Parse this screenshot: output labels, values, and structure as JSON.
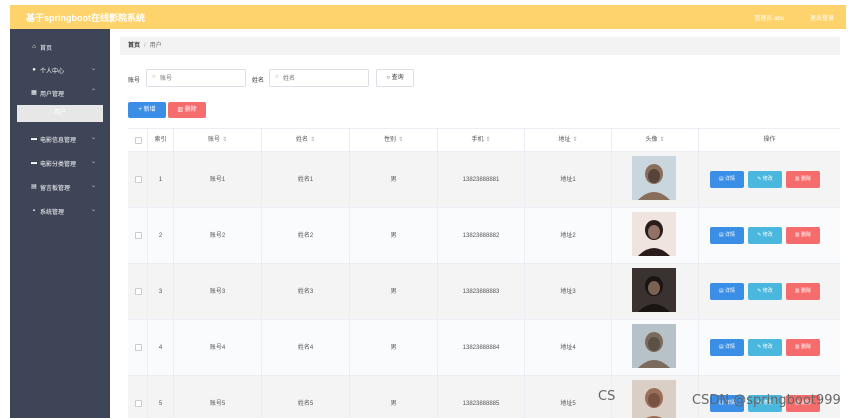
{
  "header": {
    "title": "基于springboot在线影院系统",
    "user_label": "管理员 abo",
    "logout_label": "退出登录"
  },
  "sidebar": {
    "items": [
      {
        "label": "首页",
        "icon": "home-icon"
      },
      {
        "label": "个人中心",
        "icon": "user-icon"
      },
      {
        "label": "用户管理",
        "icon": "grid-icon"
      },
      {
        "label": "电影信息管理",
        "icon": "film-icon"
      },
      {
        "label": "电影分类管理",
        "icon": "category-icon"
      },
      {
        "label": "留言板管理",
        "icon": "message-icon"
      },
      {
        "label": "系统管理",
        "icon": "settings-icon"
      }
    ],
    "active_sub": "用户"
  },
  "breadcrumb": {
    "home": "首页",
    "separator": "/",
    "current": "用户"
  },
  "search": {
    "account_label": "账号",
    "account_placeholder": "账号",
    "name_label": "姓名",
    "name_placeholder": "姓名",
    "query_label": "查询"
  },
  "actions": {
    "add_label": "新增",
    "delete_label": "删除"
  },
  "table": {
    "headers": [
      "索引",
      "账号",
      "姓名",
      "性别",
      "手机",
      "地址",
      "头像",
      "操作"
    ],
    "op_labels": {
      "detail": "详情",
      "edit": "修改",
      "remove": "删除"
    },
    "rows": [
      {
        "index": "1",
        "account": "账号1",
        "name": "姓名1",
        "gender": "男",
        "phone": "13823888881",
        "address": "地址1"
      },
      {
        "index": "2",
        "account": "账号2",
        "name": "姓名2",
        "gender": "男",
        "phone": "13823888882",
        "address": "地址2"
      },
      {
        "index": "3",
        "account": "账号3",
        "name": "姓名3",
        "gender": "男",
        "phone": "13823888883",
        "address": "地址3"
      },
      {
        "index": "4",
        "account": "账号4",
        "name": "姓名4",
        "gender": "男",
        "phone": "13823888884",
        "address": "地址4"
      },
      {
        "index": "5",
        "account": "账号5",
        "name": "姓名5",
        "gender": "男",
        "phone": "13823888885",
        "address": "地址5"
      }
    ]
  },
  "watermark": "CSDN @springboot999",
  "colors": {
    "topbar": "#ffd36b",
    "sidebar": "#3d4557",
    "primary": "#3a8ee6",
    "info": "#4ab7de",
    "danger": "#f56c6c"
  }
}
